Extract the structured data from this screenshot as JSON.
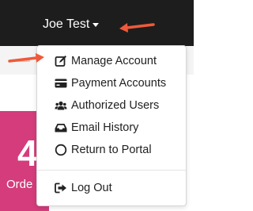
{
  "header": {
    "user_name": "Joe Test"
  },
  "stat_card": {
    "number": "4",
    "label": "Orde"
  },
  "menu": {
    "items": [
      {
        "label": "Manage Account",
        "icon": "edit-icon"
      },
      {
        "label": "Payment Accounts",
        "icon": "credit-card-icon"
      },
      {
        "label": "Authorized Users",
        "icon": "users-icon"
      },
      {
        "label": "Email History",
        "icon": "inbox-icon"
      },
      {
        "label": "Return to Portal",
        "icon": "circle-icon"
      }
    ],
    "logout": {
      "label": "Log Out",
      "icon": "sign-out-icon"
    }
  },
  "colors": {
    "topbar": "#1d1d1d",
    "card": "#d43c7c",
    "annotation_arrow": "#ee5a3a"
  }
}
